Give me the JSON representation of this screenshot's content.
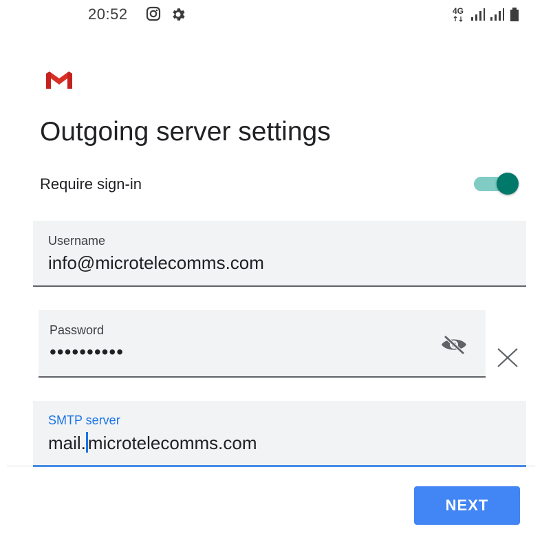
{
  "status_bar": {
    "time": "20:52",
    "icons": [
      "instagram-icon",
      "gear-icon"
    ],
    "network": "4G",
    "right_icons": [
      "network-4g-icon",
      "signal-icon",
      "signal-icon",
      "battery-icon"
    ]
  },
  "header": {
    "logo": "gmail-logo",
    "title": "Outgoing server settings"
  },
  "require_signin": {
    "label": "Require sign-in",
    "enabled": true
  },
  "fields": {
    "username": {
      "label": "Username",
      "value": "info@microtelecomms.com"
    },
    "password": {
      "label": "Password",
      "value": "••••••••••",
      "visibility_icon": "eye-off-icon",
      "clear_icon": "close-icon"
    },
    "smtp_server": {
      "label": "SMTP server",
      "value_before_cursor": "mail.",
      "value_after_cursor": "microtelecomms.com"
    }
  },
  "actions": {
    "next_label": "NEXT"
  },
  "colors": {
    "accent": "#1a73e8",
    "toggle_thumb": "#00796b",
    "toggle_track": "#80cbc4",
    "button": "#4285f4",
    "field_bg": "#f1f3f4",
    "gmail_red": "#d93025"
  }
}
